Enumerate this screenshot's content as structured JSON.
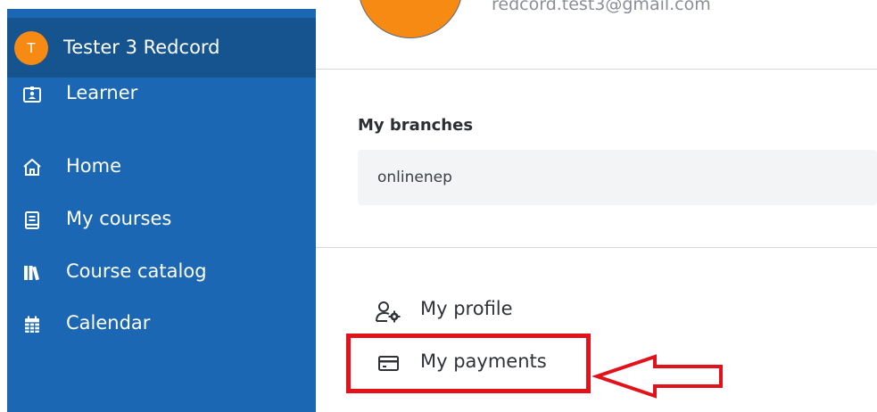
{
  "sidebar": {
    "user": {
      "initial": "T",
      "name": "Tester 3 Redcord"
    },
    "role": {
      "label": "Learner",
      "icon": "id-badge-icon"
    },
    "items": [
      {
        "label": "Home",
        "icon": "home-icon"
      },
      {
        "label": "My courses",
        "icon": "book-icon"
      },
      {
        "label": "Course catalog",
        "icon": "library-icon"
      },
      {
        "label": "Calendar",
        "icon": "calendar-icon"
      }
    ]
  },
  "profile": {
    "email": "redcord.test3@gmail.com"
  },
  "branches": {
    "title": "My branches",
    "items": [
      "onlinenep"
    ]
  },
  "menu": {
    "profile_label": "My profile",
    "payments_label": "My payments"
  },
  "colors": {
    "sidebar": "#1b67b3",
    "sidebar_header": "#15548f",
    "avatar": "#f78a12",
    "annotation": "#e3121a"
  }
}
